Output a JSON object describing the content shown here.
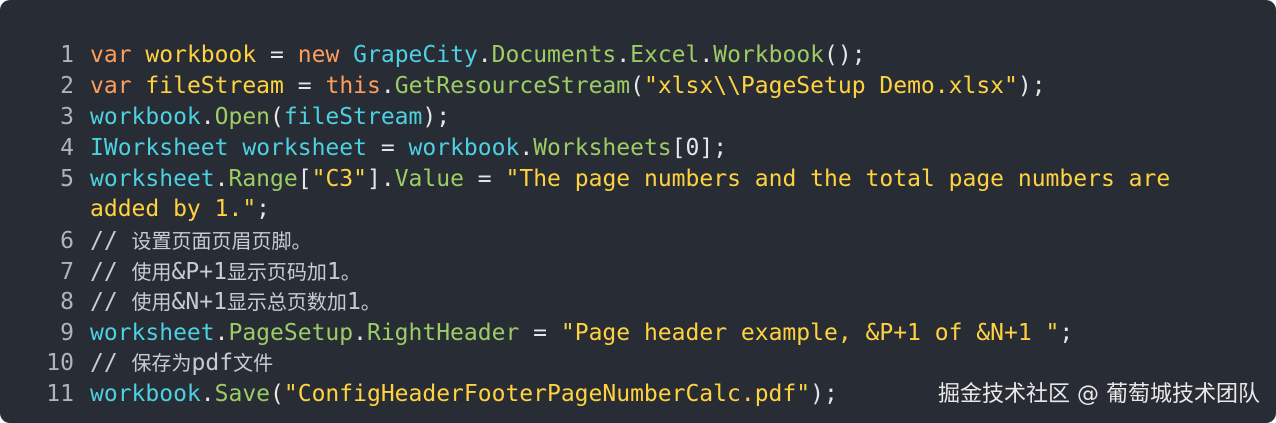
{
  "colors": {
    "background": "#282c34",
    "keyword": "#ff9d5c",
    "type": "#4dd0e1",
    "method": "#9ccc65",
    "string": "#ffd23f",
    "plain": "#e6e6e6",
    "line_number": "#b0b3b8",
    "comment": "#c8cbd0"
  },
  "lines": [
    {
      "number": "1",
      "tokens": [
        {
          "t": "var",
          "c": "kw"
        },
        {
          "t": " ",
          "c": "plain"
        },
        {
          "t": "workbook",
          "c": "str"
        },
        {
          "t": " ",
          "c": "plain"
        },
        {
          "t": "=",
          "c": "plain"
        },
        {
          "t": " ",
          "c": "plain"
        },
        {
          "t": "new",
          "c": "kw"
        },
        {
          "t": " ",
          "c": "plain"
        },
        {
          "t": "GrapeCity",
          "c": "cls"
        },
        {
          "t": ".",
          "c": "plain"
        },
        {
          "t": "Documents",
          "c": "meth"
        },
        {
          "t": ".",
          "c": "plain"
        },
        {
          "t": "Excel",
          "c": "meth"
        },
        {
          "t": ".",
          "c": "plain"
        },
        {
          "t": "Workbook",
          "c": "meth"
        },
        {
          "t": "();",
          "c": "plain"
        }
      ]
    },
    {
      "number": "2",
      "tokens": [
        {
          "t": "var",
          "c": "kw"
        },
        {
          "t": " ",
          "c": "plain"
        },
        {
          "t": "fileStream",
          "c": "str"
        },
        {
          "t": " ",
          "c": "plain"
        },
        {
          "t": "=",
          "c": "plain"
        },
        {
          "t": " ",
          "c": "plain"
        },
        {
          "t": "this",
          "c": "kw"
        },
        {
          "t": ".",
          "c": "plain"
        },
        {
          "t": "GetResourceStream",
          "c": "meth"
        },
        {
          "t": "(",
          "c": "plain"
        },
        {
          "t": "\"xlsx\\\\PageSetup Demo.xlsx\"",
          "c": "str"
        },
        {
          "t": ");",
          "c": "plain"
        }
      ]
    },
    {
      "number": "3",
      "tokens": [
        {
          "t": "workbook",
          "c": "cls"
        },
        {
          "t": ".",
          "c": "plain"
        },
        {
          "t": "Open",
          "c": "meth"
        },
        {
          "t": "(",
          "c": "plain"
        },
        {
          "t": "fileStream",
          "c": "cls"
        },
        {
          "t": ");",
          "c": "plain"
        }
      ]
    },
    {
      "number": "4",
      "tokens": [
        {
          "t": "IWorksheet",
          "c": "cls"
        },
        {
          "t": " ",
          "c": "plain"
        },
        {
          "t": "worksheet",
          "c": "cls"
        },
        {
          "t": " ",
          "c": "plain"
        },
        {
          "t": "=",
          "c": "plain"
        },
        {
          "t": " ",
          "c": "plain"
        },
        {
          "t": "workbook",
          "c": "cls"
        },
        {
          "t": ".",
          "c": "plain"
        },
        {
          "t": "Worksheets",
          "c": "meth"
        },
        {
          "t": "[",
          "c": "plain"
        },
        {
          "t": "0",
          "c": "num"
        },
        {
          "t": "];",
          "c": "plain"
        }
      ]
    },
    {
      "number": "5",
      "tokens": [
        {
          "t": "worksheet",
          "c": "cls"
        },
        {
          "t": ".",
          "c": "plain"
        },
        {
          "t": "Range",
          "c": "meth"
        },
        {
          "t": "[",
          "c": "plain"
        },
        {
          "t": "\"C3\"",
          "c": "str"
        },
        {
          "t": "].",
          "c": "plain"
        },
        {
          "t": "Value",
          "c": "meth"
        },
        {
          "t": " ",
          "c": "plain"
        },
        {
          "t": "=",
          "c": "plain"
        },
        {
          "t": " ",
          "c": "plain"
        },
        {
          "t": "\"The page numbers and the total page numbers are",
          "c": "str"
        }
      ]
    },
    {
      "number": "",
      "continuation": true,
      "tokens": [
        {
          "t": "added by 1.\"",
          "c": "str"
        },
        {
          "t": ";",
          "c": "plain"
        }
      ]
    },
    {
      "number": "6",
      "tokens": [
        {
          "t": "// ",
          "c": "cm"
        },
        {
          "t": "设置页面页眉页脚。",
          "c": "cm cjk"
        }
      ]
    },
    {
      "number": "7",
      "tokens": [
        {
          "t": "// ",
          "c": "cm"
        },
        {
          "t": "使用",
          "c": "cm cjk"
        },
        {
          "t": "&P+1",
          "c": "cm"
        },
        {
          "t": "显示页码加",
          "c": "cm cjk"
        },
        {
          "t": "1",
          "c": "cm"
        },
        {
          "t": "。",
          "c": "cm cjk"
        }
      ]
    },
    {
      "number": "8",
      "tokens": [
        {
          "t": "// ",
          "c": "cm"
        },
        {
          "t": "使用",
          "c": "cm cjk"
        },
        {
          "t": "&N+1",
          "c": "cm"
        },
        {
          "t": "显示总页数加",
          "c": "cm cjk"
        },
        {
          "t": "1",
          "c": "cm"
        },
        {
          "t": "。",
          "c": "cm cjk"
        }
      ]
    },
    {
      "number": "9",
      "tokens": [
        {
          "t": "worksheet",
          "c": "cls"
        },
        {
          "t": ".",
          "c": "plain"
        },
        {
          "t": "PageSetup",
          "c": "meth"
        },
        {
          "t": ".",
          "c": "plain"
        },
        {
          "t": "RightHeader",
          "c": "meth"
        },
        {
          "t": " ",
          "c": "plain"
        },
        {
          "t": "=",
          "c": "plain"
        },
        {
          "t": " ",
          "c": "plain"
        },
        {
          "t": "\"Page header example, &P+1 of &N+1 \"",
          "c": "str"
        },
        {
          "t": ";",
          "c": "plain"
        }
      ]
    },
    {
      "number": "10",
      "tokens": [
        {
          "t": "// ",
          "c": "cm"
        },
        {
          "t": "保存为",
          "c": "cm cjk"
        },
        {
          "t": "pdf",
          "c": "cm"
        },
        {
          "t": "文件",
          "c": "cm cjk"
        }
      ]
    },
    {
      "number": "11",
      "tokens": [
        {
          "t": "workbook",
          "c": "cls"
        },
        {
          "t": ".",
          "c": "plain"
        },
        {
          "t": "Save",
          "c": "meth"
        },
        {
          "t": "(",
          "c": "plain"
        },
        {
          "t": "\"ConfigHeaderFooterPageNumberCalc.pdf\"",
          "c": "str"
        },
        {
          "t": ");",
          "c": "plain"
        }
      ]
    }
  ],
  "watermark": {
    "text": "掘金技术社区 @ 葡萄城技术团队"
  }
}
